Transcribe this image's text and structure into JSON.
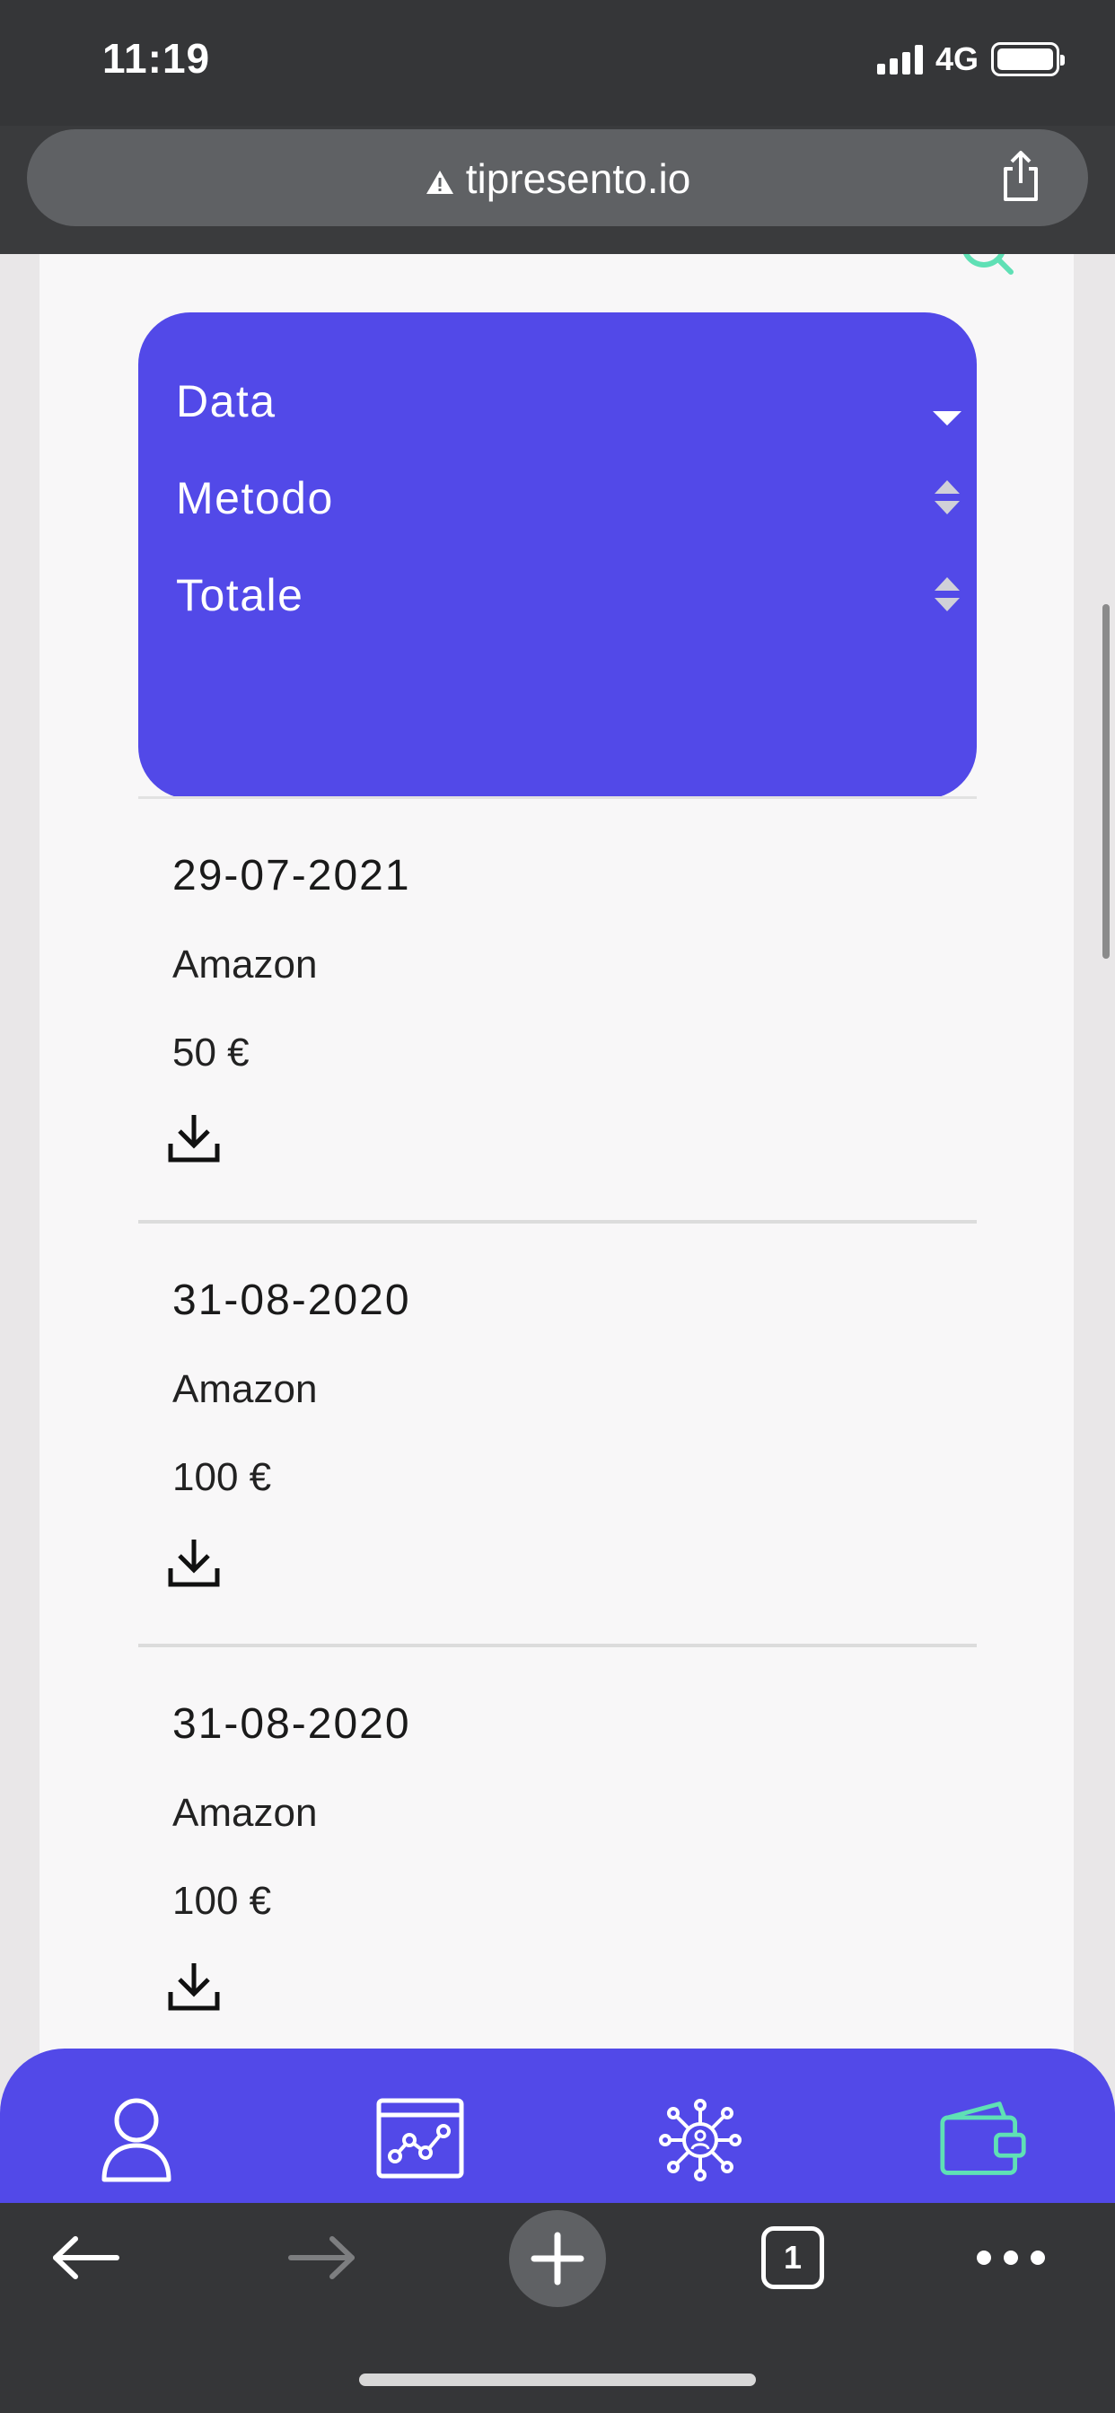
{
  "status_bar": {
    "time": "11:19",
    "network": "4G"
  },
  "browser": {
    "url": "tipresento.io",
    "tab_count": "1"
  },
  "sort_panel": {
    "options": [
      {
        "label": "Data",
        "sort_state": "descending"
      },
      {
        "label": "Metodo",
        "sort_state": "unsorted"
      },
      {
        "label": "Totale",
        "sort_state": "unsorted"
      }
    ]
  },
  "transactions": [
    {
      "date": "29-07-2021",
      "method": "Amazon",
      "total": "50 €"
    },
    {
      "date": "31-08-2020",
      "method": "Amazon",
      "total": "100 €"
    },
    {
      "date": "31-08-2020",
      "method": "Amazon",
      "total": "100 €"
    }
  ],
  "app_nav": {
    "items": [
      {
        "icon": "profile-icon",
        "active": false
      },
      {
        "icon": "analytics-icon",
        "active": false
      },
      {
        "icon": "network-icon",
        "active": false
      },
      {
        "icon": "wallet-icon",
        "active": true
      }
    ]
  },
  "colors": {
    "accent": "#5249e8",
    "active_icon": "#5fe0b5",
    "chrome": "#353638"
  }
}
